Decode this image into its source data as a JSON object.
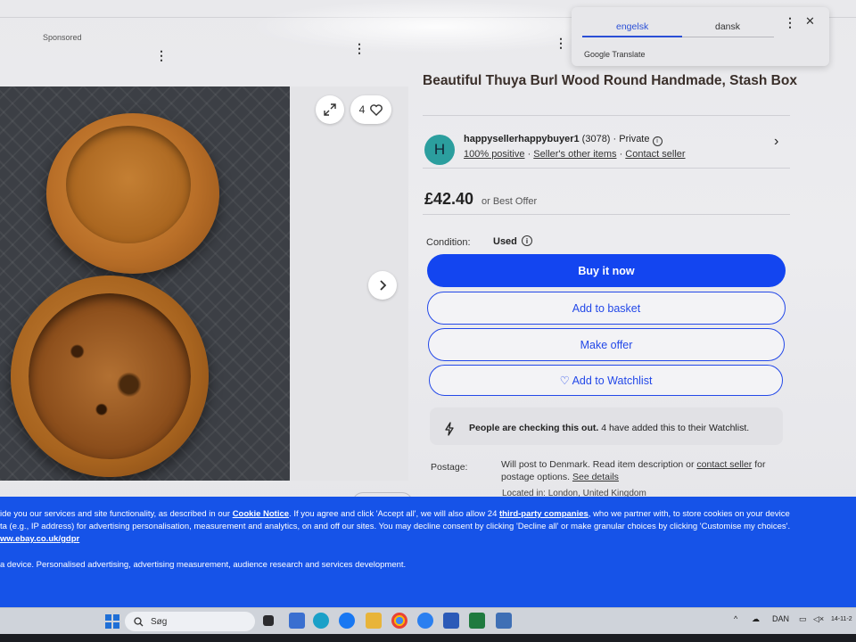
{
  "header": {
    "sponsored": "Sponsored"
  },
  "gallery": {
    "watch_count": "4",
    "expand_icon": "expand-icon",
    "heart_icon": "heart-icon",
    "next_icon": "chevron-right-icon"
  },
  "translate": {
    "lang_source": "engelsk",
    "lang_target": "dansk",
    "brand": "Google Translate",
    "menu_icon": "kebab-icon",
    "close_icon": "close-icon"
  },
  "product": {
    "title": "Beautiful Thuya Burl Wood Round Handmade, Stash Box",
    "seller": {
      "initial": "H",
      "name": "happysellerhappybuyer1",
      "feedback_count": "(3078)",
      "type": "· Private",
      "positive": "100% positive",
      "sep1": "·",
      "other_items": "Seller's other items",
      "sep2": "·",
      "contact": "Contact seller"
    },
    "price": "£42.40",
    "best_offer": "or Best Offer",
    "condition_label": "Condition:",
    "condition_value": "Used",
    "buttons": {
      "buy_now": "Buy it now",
      "add_basket": "Add to basket",
      "make_offer": "Make offer",
      "watchlist": "♡ Add to Watchlist"
    },
    "watch_notice": {
      "bold": "People are checking this out.",
      "rest": " 4 have added this to their Watchlist."
    },
    "postage": {
      "label": "Postage:",
      "text1": "Will post to Denmark. Read item description or ",
      "contact_link": "contact seller",
      "text2": " for postage options. ",
      "see_details": "See details",
      "located": "Located in: London, United Kingdom"
    }
  },
  "cookie": {
    "line1_a": "ide you our services and site functionality, as described in our ",
    "line1_link1": "Cookie Notice",
    "line1_b": ". If you agree and click 'Accept all', we will also allow 24 ",
    "line1_link2": "third-party companies",
    "line1_c": ", who we partner with, to store cookies on your device",
    "line2": "ta (e.g., IP address) for advertising personalisation, measurement and analytics, on and off our sites. You may decline consent by clicking 'Decline all' or make granular choices by clicking 'Customise my choices'.",
    "line3_link": "ww.ebay.co.uk/gdpr",
    "line4": "a device. Personalised advertising, advertising measurement, audience research and services development."
  },
  "taskbar": {
    "search_placeholder": "Søg",
    "lang": "DAN",
    "date": "14-11-2"
  }
}
